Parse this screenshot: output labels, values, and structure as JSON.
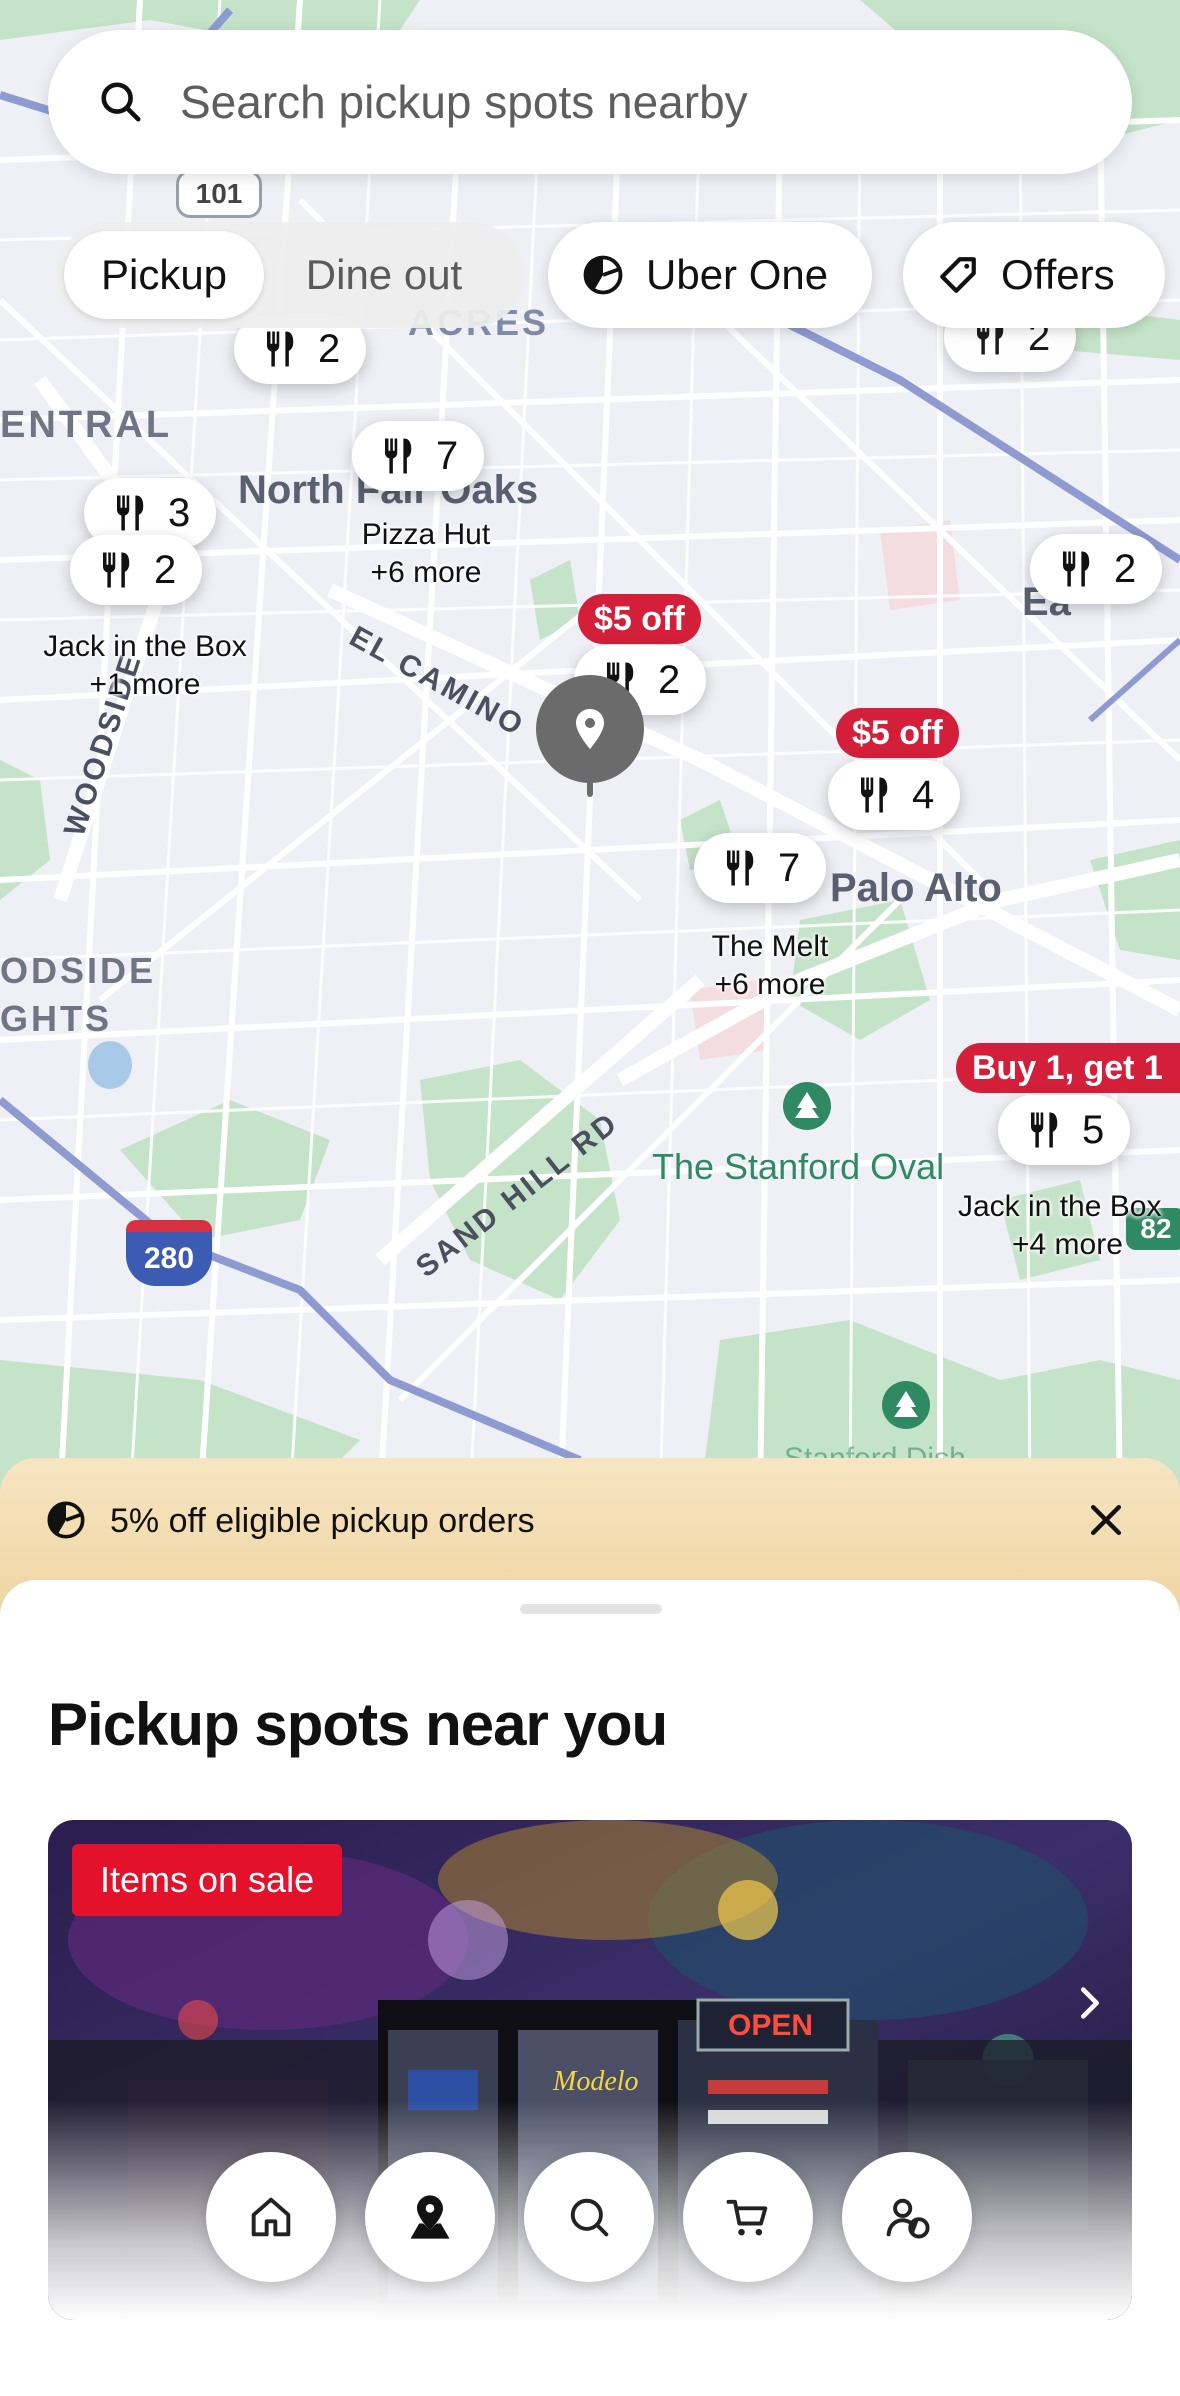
{
  "search": {
    "placeholder": "Search pickup spots nearby",
    "icon": "search-icon"
  },
  "mode_toggle": {
    "options": [
      "Pickup",
      "Dine out"
    ],
    "selected": "Pickup"
  },
  "filters": {
    "uber_one": {
      "label": "Uber One",
      "icon": "uber-one-icon"
    },
    "offers": {
      "label": "Offers",
      "icon": "tag-icon"
    }
  },
  "map": {
    "area_labels": [
      "ENTRAL",
      "North Fair Oaks",
      "Palo Alto",
      "ODSIDE",
      "GHTS",
      "ACRES",
      "Ea"
    ],
    "road_labels": [
      "EL CAMINO",
      "WOODSIDE",
      "SAND HILL RD"
    ],
    "park_labels": [
      "The Stanford Oval",
      "Stanford Dish"
    ],
    "shields": [
      "101",
      "280",
      "82"
    ],
    "markers": [
      {
        "count": "2",
        "promo": "",
        "caption": ""
      },
      {
        "count": "2",
        "promo": "",
        "caption": ""
      },
      {
        "count": "3",
        "promo": "",
        "caption": ""
      },
      {
        "count": "2",
        "promo": "",
        "caption": "Jack in the Box\n+1 more",
        "caption_line1": "Jack in the Box",
        "caption_line2": "+1 more"
      },
      {
        "count": "7",
        "promo": "",
        "caption_line1": "Pizza Hut",
        "caption_line2": "+6 more"
      },
      {
        "count": "2",
        "promo": "$5 off",
        "caption_line1": "",
        "caption_line2": ""
      },
      {
        "count": "2",
        "promo": "",
        "caption_line1": "",
        "caption_line2": ""
      },
      {
        "count": "4",
        "promo": "$5 off",
        "caption_line1": "",
        "caption_line2": ""
      },
      {
        "count": "7",
        "promo": "",
        "caption_line1": "The Melt",
        "caption_line2": "+6 more"
      },
      {
        "count": "5",
        "promo": "Buy 1, get 1",
        "caption_line1": "Jack in the Box",
        "caption_line2": "+4 more"
      }
    ]
  },
  "promo_banner": {
    "text": "5% off eligible pickup orders",
    "icon": "uber-one-icon",
    "close_icon": "close-icon"
  },
  "sheet": {
    "title": "Pickup spots near you",
    "card": {
      "badge": "Items on sale",
      "next_icon": "chevron-right-icon",
      "sign_text": "OPEN",
      "neon_text": "Modelo"
    }
  },
  "bottom_nav": [
    "home-icon",
    "map-pin-icon",
    "search-icon",
    "cart-icon",
    "account-icon"
  ],
  "colors": {
    "promo_red": "#d41f3a",
    "sale_red": "#e4112b",
    "banner_gold": "#eed3a0",
    "park_green": "#2f8a63"
  }
}
